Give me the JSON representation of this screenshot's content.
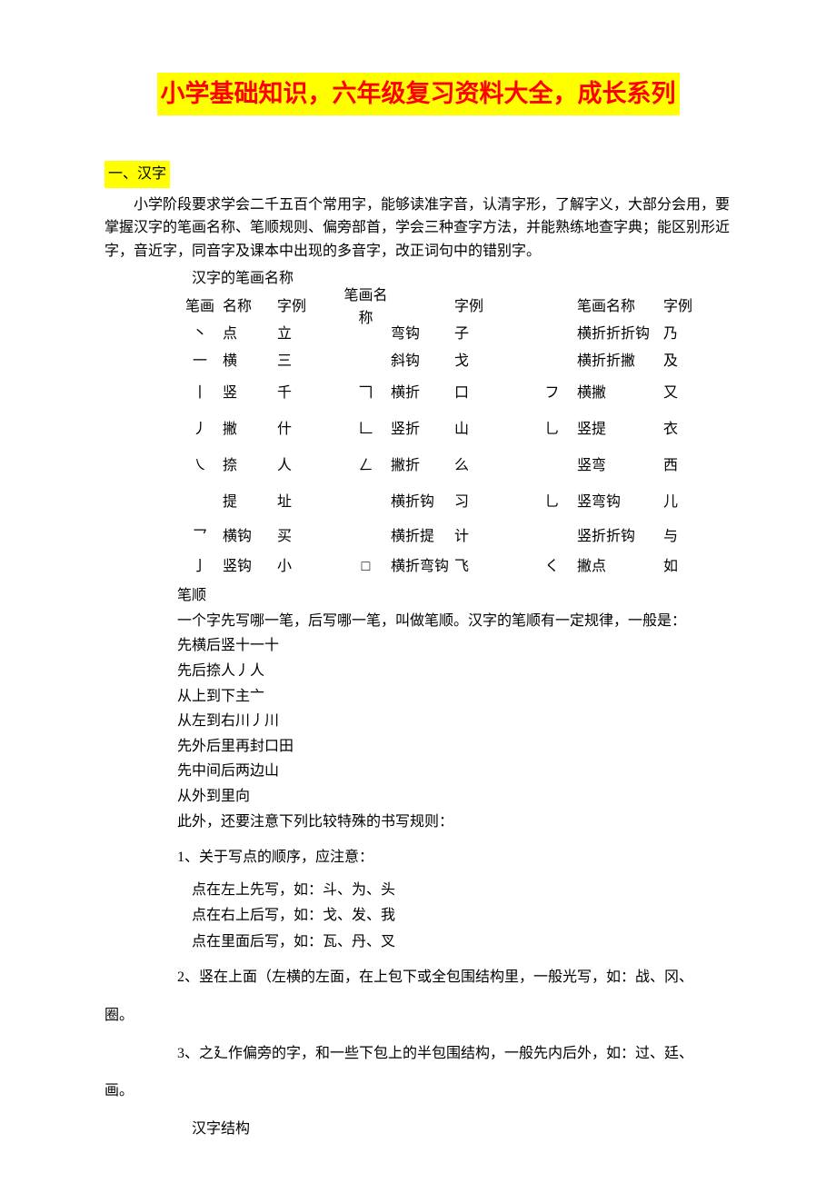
{
  "title": "小学基础知识，六年级复习资料大全，成长系列",
  "section1": {
    "header": "一、汉字",
    "intro1": "小学阶段要求学会二千五百个常用字，能够读准字音，认清字形，了解字义，大部分会用，要掌握汉字的笔画名称、笔顺规则、偏旁部首，学会三种查字方法，并能熟练地查字典；能区别形近字，音近字，同音字及课本中出现的多音字，改正词句中的错别字。",
    "subhead1": "汉字的笔画名称",
    "table_header": {
      "h1": "笔画",
      "h2": "名称",
      "h3": "字例",
      "h4": "笔画",
      "h5": "名称",
      "h6": "字例",
      "h7": "笔画",
      "h8": "名称",
      "h9": "字例"
    },
    "rows": [
      {
        "s": "丶",
        "n": "点",
        "e": "立",
        "s2": "",
        "n2": "弯钩",
        "e2": "子",
        "s3": "",
        "n3": "横折折折钩",
        "e3": "乃"
      },
      {
        "s": "一",
        "n": "横",
        "e": "三",
        "s2": "",
        "n2": "斜钩",
        "e2": "戈",
        "s3": "",
        "n3": "横折折撇",
        "e3": "及"
      },
      {
        "s": "丨",
        "n": "竖",
        "e": "千",
        "s2": "𠃍",
        "n2": "横折",
        "e2": "口",
        "s3": "フ",
        "n3": "横撇",
        "e3": "又"
      },
      {
        "s": "丿",
        "n": "撇",
        "e": "什",
        "s2": "𠃊",
        "n2": "竖折",
        "e2": "山",
        "s3": "乚",
        "n3": "竖提",
        "e3": "衣"
      },
      {
        "s": "㇏",
        "n": "捺",
        "e": "人",
        "s2": "ㄥ",
        "n2": "撇折",
        "e2": "么",
        "s3": "",
        "n3": "竖弯",
        "e3": "西"
      },
      {
        "s": "",
        "n": "提",
        "e": "址",
        "s2": "",
        "n2": "横折钩",
        "e2": "习",
        "s3": "乚",
        "n3": "竖弯钩",
        "e3": "儿"
      },
      {
        "s": "乛",
        "n": "横钩",
        "e": "买",
        "s2": "",
        "n2": "横折提",
        "e2": "计",
        "s3": "",
        "n3": "竖折折钩",
        "e3": "与"
      },
      {
        "s": "亅",
        "n": "竖钩",
        "e": "小",
        "s2": "",
        "n2": "横折弯钩",
        "e2": "飞",
        "s3": "く",
        "n3": "撇点",
        "e3": "如"
      }
    ],
    "stroke_order_title": "笔顺",
    "so_lines": [
      "一个字先写哪一笔，后写哪一笔，叫做笔顺。汉字的笔顺有一定规律，一般是：",
      "先横后竖十一十",
      "先后捺人丿人",
      "从上到下主亠",
      "从左到右川丿川",
      "先外后里再封口田",
      "先中间后两边山",
      "从外到里向",
      "此外，还要注意下列比较特殊的书写规则："
    ],
    "num1": "1、关于写点的顺序，应注意：",
    "sub1": [
      "点在左上先写，如：斗、为、头",
      "点在右上后写，如：戈、发、我",
      "点在里面后写，如：瓦、丹、叉"
    ],
    "num2": "2、竖在上面（左横的左面，在上包下或全包围结构里，一般光写，如：战、冈、",
    "num2_tail": "圈。",
    "num3": "3、之廴作偏旁的字，和一些下包上的半包围结构，一般先内后外，如：过、廷、",
    "num3_tail": "画。",
    "structure_head": "汉字结构"
  }
}
